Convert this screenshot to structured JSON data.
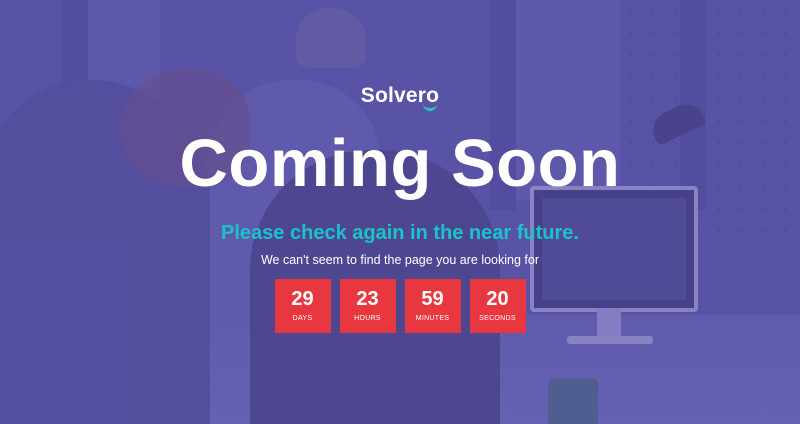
{
  "brand": {
    "logo_text": "Solvero",
    "accent_color": "#22c7b8"
  },
  "hero": {
    "title": "Coming Soon",
    "subtitle": "Please check again in the near future.",
    "description": "We can't seem to find the page you are looking for"
  },
  "countdown": [
    {
      "value": "29",
      "label": "DAYS"
    },
    {
      "value": "23",
      "label": "HOURS"
    },
    {
      "value": "59",
      "label": "MINUTES"
    },
    {
      "value": "20",
      "label": "SECONDS"
    }
  ],
  "colors": {
    "overlay": "#5a55a6",
    "countdown_box": "#e8373f",
    "subtitle": "#19c3c8"
  },
  "background": {
    "icon": "office-team-photo"
  }
}
